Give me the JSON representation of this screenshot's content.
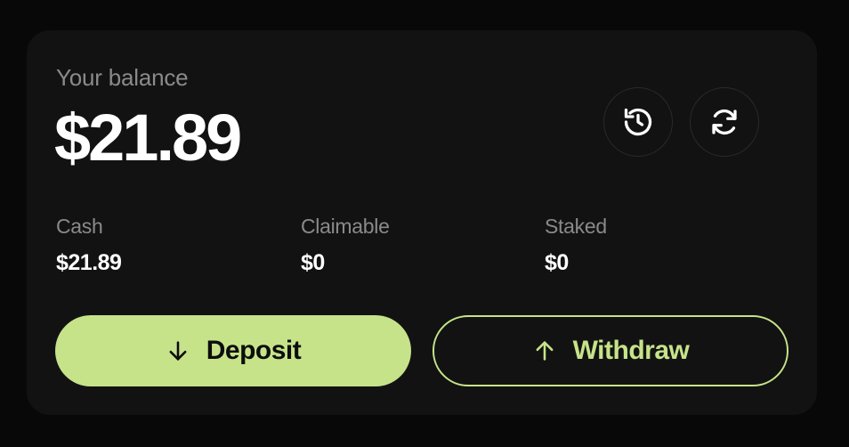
{
  "balance": {
    "label": "Your balance",
    "amount": "$21.89"
  },
  "actions": {
    "history_icon": "history-icon",
    "refresh_icon": "refresh-icon"
  },
  "stats": [
    {
      "label": "Cash",
      "value": "$21.89"
    },
    {
      "label": "Claimable",
      "value": "$0"
    },
    {
      "label": "Staked",
      "value": "$0"
    }
  ],
  "buttons": {
    "deposit_label": "Deposit",
    "deposit_icon": "arrow-down-icon",
    "withdraw_label": "Withdraw",
    "withdraw_icon": "arrow-up-icon"
  },
  "colors": {
    "accent": "#c6e38a",
    "background": "#080808",
    "card": "#121212",
    "muted_text": "#8a8a8a",
    "primary_text": "#ffffff"
  }
}
